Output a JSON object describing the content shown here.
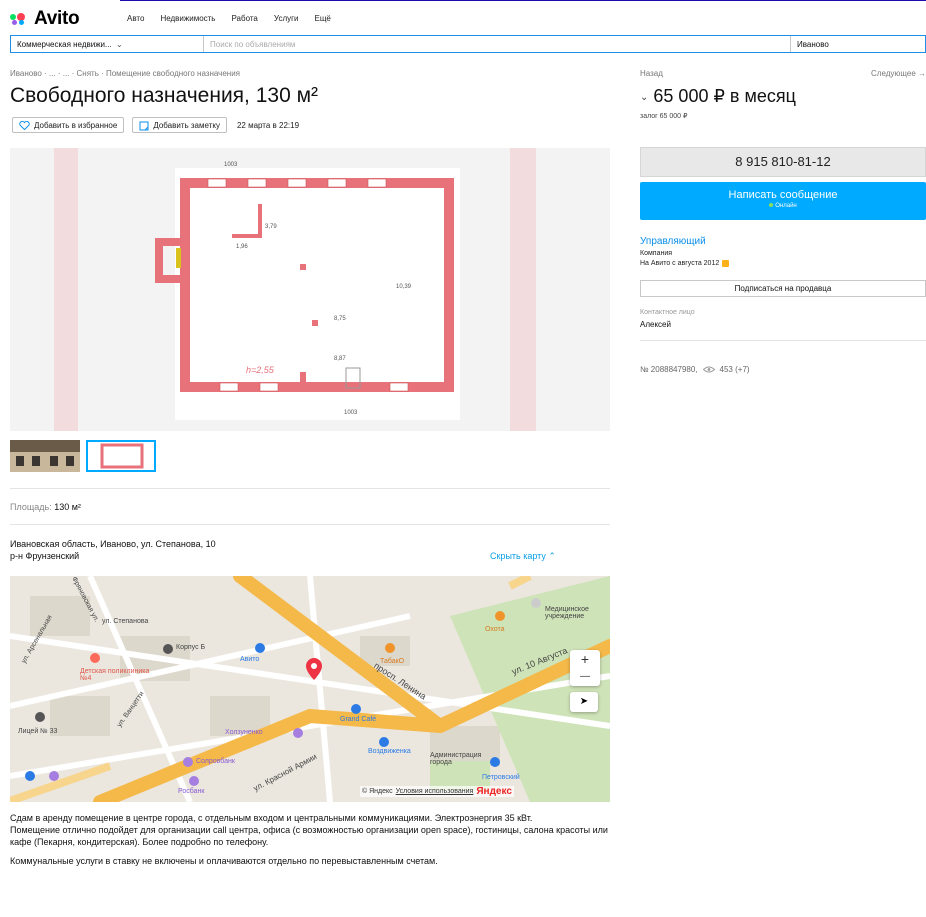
{
  "header": {
    "logo_text": "Avito",
    "nav": [
      "Авто",
      "Недвижимость",
      "Работа",
      "Услуги",
      "Ещё"
    ]
  },
  "search": {
    "category": "Коммерческая недвижи...",
    "placeholder": "Поиск по объявлениям",
    "city": "Иваново"
  },
  "breadcrumbs": "Иваново · ... · ... · Снять · Помещение свободного назначения",
  "listing": {
    "title": "Свободного назначения, 130 м²",
    "favorite_label": "Добавить в избранное",
    "note_label": "Добавить заметку",
    "date": "22 марта в 22:19",
    "area_label": "Площадь:",
    "area_value": "130 м²",
    "address": "Ивановская область, Иваново, ул. Степанова, 10",
    "district": "р-н Фрунзенский",
    "hide_map": "Скрыть карту ⌃",
    "description": [
      "Сдам в аренду помещение в центре города, с отдельным входом и центральными коммуникациями. Электроэнергия 35 кВт.",
      "Помещение отлично подойдет для организации call центра, офиса (с возможностью организации open space), гостиницы, салона красоты или кафе (Пекарня, кондитерская). Более подробно по телефону.",
      "Коммунальные услуги в ставку не включены и оплачиваются отдельно по перевыставленным счетам."
    ]
  },
  "floorplan": {
    "label_top": "1003",
    "label_bottom": "1003",
    "height_label": "h=2,55",
    "dims": [
      "3,79",
      "1,96",
      "8,75",
      "8,87",
      "10,39"
    ]
  },
  "map": {
    "labels": {
      "stepanova": "ул. Степанова",
      "korpus": "Корпус Б",
      "avito": "Авито",
      "child_poly": "Детская поликлиника №4",
      "tabako": "ТабакО",
      "lenina": "просп. Ленина",
      "oct10": "ул. 10 Августа",
      "grand": "Grand Café",
      "vozdvizh": "Воздвиженка",
      "kholzunov": "Холзуненко",
      "tolrobank": "Солровбанк",
      "admin": "Администрация города",
      "petrovsky": "Петровский",
      "krasarmy": "ул. Красной Армии",
      "lyceum": "Лицей № 33",
      "rosbank": "Росбанк",
      "medical": "Медицинское учреждение",
      "okhta": "Охота",
      "arsenalnaya": "ул. Арсенальная",
      "ivanova": "ул. Ванцетти",
      "fryanskaya": "Фряновская ул."
    },
    "zoom_in": "+",
    "zoom_out": "—",
    "locate": "➤",
    "copyright": "© Яндекс",
    "terms": "Условия использования",
    "brand": "Яндекс"
  },
  "sidebar": {
    "back": "Назад",
    "next": "Следующее →",
    "price": "65 000 ₽ в месяц",
    "deposit": "залог 65 000 ₽",
    "phone": "8 915 810-81-12",
    "message_label": "Написать сообщение",
    "online_label": "Онлайн",
    "seller_name": "Управляющий",
    "seller_type": "Компания",
    "seller_since": "На Авито с августа 2012",
    "subscribe_label": "Подписаться на продавца",
    "contact_label": "Контактное лицо",
    "contact_name": "Алексей",
    "ad_number": "№ 2088847980,",
    "views": "453 (+7)"
  },
  "colors": {
    "accent": "#00aaff",
    "link": "#0a8ee8",
    "wall": "#e8727a",
    "road": "#f5b94a",
    "map_pin": "#ee3344"
  }
}
